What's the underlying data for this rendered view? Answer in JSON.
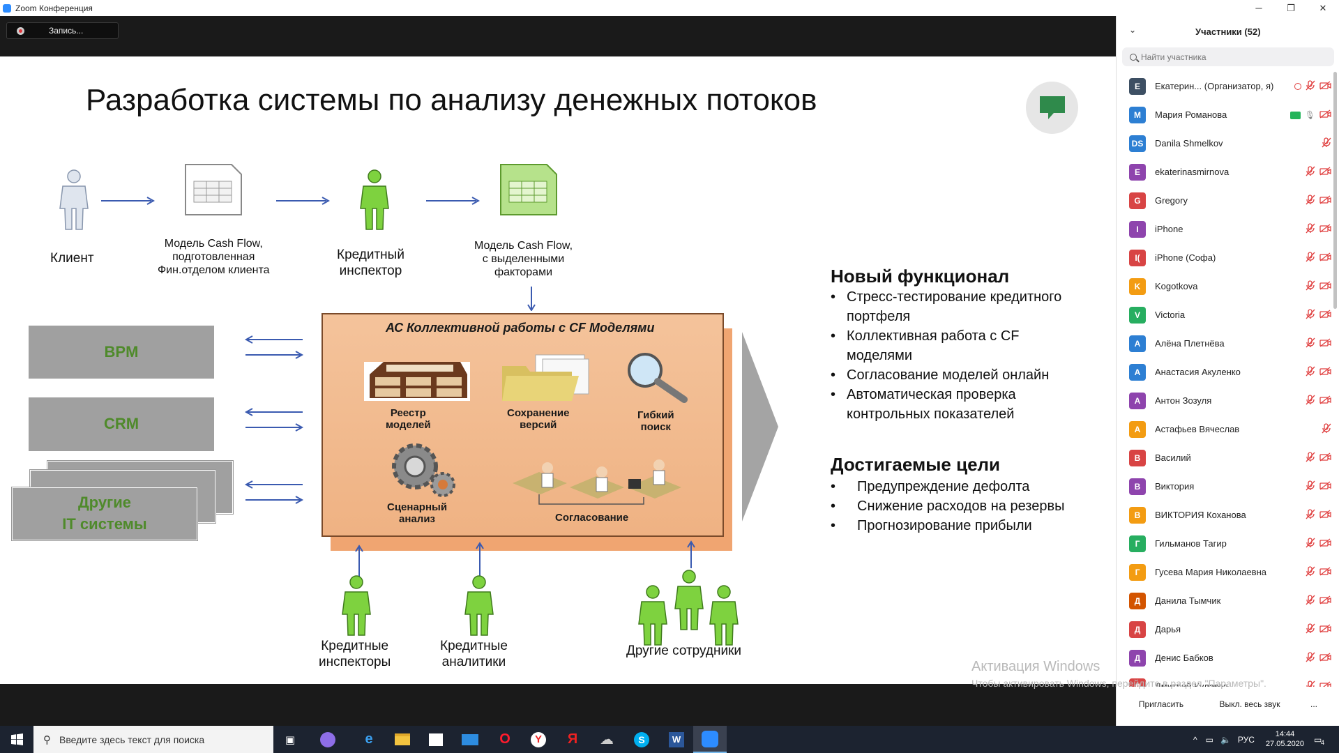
{
  "window": {
    "title": "Zoom Конференция"
  },
  "toolbar": {
    "record_label": "Запись..."
  },
  "slide": {
    "title": "Разработка системы по анализу денежных потоков",
    "flow_labels": {
      "client": "Клиент",
      "model1": "Модель Cash Flow,\nподготовленная\nФин.отделом клиента",
      "inspector": "Кредитный\nинспектор",
      "model2": "Модель Cash Flow,\nс выделенными\nфакторами"
    },
    "systems": [
      "BPM",
      "CRM",
      "Другие\nIT системы"
    ],
    "ac_box": {
      "title": "АС Коллективной работы с CF Моделями",
      "modules": [
        "Реестр\nмоделей",
        "Сохранение\nверсий",
        "Гибкий\nпоиск",
        "Сценарный\nанализ",
        "Согласование"
      ]
    },
    "bottom_labels": [
      "Кредитные\nинспекторы",
      "Кредитные\nаналитики",
      "Другие сотрудники"
    ],
    "new_features": {
      "title": "Новый функционал",
      "items": [
        "Стресс-тестирование кредитного\nпортфеля",
        "Коллективная работа с CF\nмоделями",
        "Согласование моделей онлайн",
        "Автоматическая проверка\nконтрольных показателей"
      ]
    },
    "goals": {
      "title": "Достигаемые цели",
      "items": [
        "Предупреждение дефолта",
        "Снижение расходов на резервы",
        "Прогнозирование прибыли"
      ]
    }
  },
  "activation": {
    "line1": "Активация Windows",
    "line2": "Чтобы активировать Windows, перейдите в раздел \"Параметры\"."
  },
  "participants": {
    "title": "Участники (52)",
    "search_placeholder": "Найти участника",
    "list": [
      {
        "initials": "E",
        "name": "Екатерин...  (Организатор, я)",
        "color": "#3d4f63"
      },
      {
        "initials": "M",
        "name": "Мария Романова",
        "color": "#2d7fd3"
      },
      {
        "initials": "DS",
        "name": "Danila Shmelkov",
        "color": "#2d7fd3"
      },
      {
        "initials": "E",
        "name": "ekaterinasmirnova",
        "color": "#8e44ad"
      },
      {
        "initials": "G",
        "name": "Gregory",
        "color": "#d84444"
      },
      {
        "initials": "I",
        "name": "iPhone",
        "color": "#8e44ad"
      },
      {
        "initials": "I(",
        "name": "iPhone (Софа)",
        "color": "#d84444"
      },
      {
        "initials": "K",
        "name": "Kogotkova",
        "color": "#f39c12"
      },
      {
        "initials": "V",
        "name": "Victoria",
        "color": "#27ae60"
      },
      {
        "initials": "А",
        "name": "Алёна Плетнёва",
        "color": "#2d7fd3"
      },
      {
        "initials": "А",
        "name": "Анастасия Акуленко",
        "color": "#2d7fd3"
      },
      {
        "initials": "А",
        "name": "Антон Зозуля",
        "color": "#8e44ad"
      },
      {
        "initials": "А",
        "name": "Астафьев Вячеслав",
        "color": "#f39c12"
      },
      {
        "initials": "В",
        "name": "Василий",
        "color": "#d84444"
      },
      {
        "initials": "В",
        "name": "Виктория",
        "color": "#8e44ad"
      },
      {
        "initials": "В",
        "name": "ВИКТОРИЯ Коханова",
        "color": "#f39c12"
      },
      {
        "initials": "Г",
        "name": "Гильманов Тагир",
        "color": "#27ae60"
      },
      {
        "initials": "Г",
        "name": "Гусева Мария Николаевна",
        "color": "#f39c12"
      },
      {
        "initials": "Д",
        "name": "Данила Тымчик",
        "color": "#d35400"
      },
      {
        "initials": "Д",
        "name": "Дарья",
        "color": "#d84444"
      },
      {
        "initials": "Д",
        "name": "Денис Бабков",
        "color": "#8e44ad"
      },
      {
        "initials": "Д",
        "name": "Дмитрий Кулаков",
        "color": "#d84444"
      }
    ],
    "invite_label": "Пригласить",
    "mute_all_label": "Выкл. весь звук",
    "more_label": "..."
  },
  "taskbar": {
    "search_placeholder": "Введите здесь текст для поиска",
    "lang": "РУС",
    "time": "14:44",
    "date": "27.05.2020",
    "notifications": "4"
  }
}
